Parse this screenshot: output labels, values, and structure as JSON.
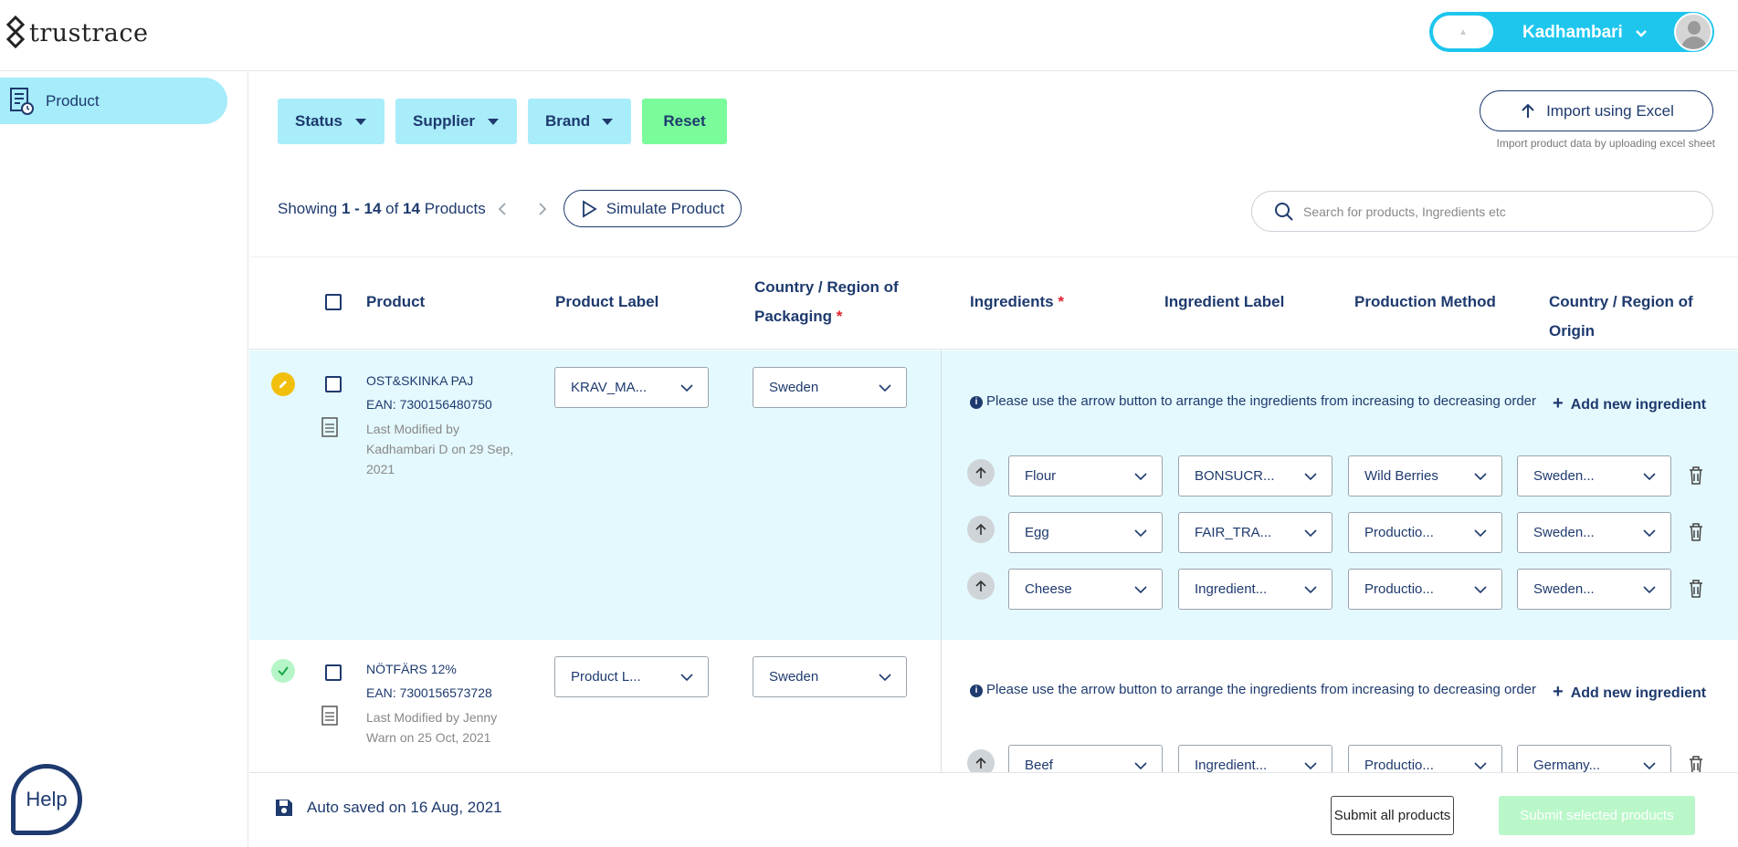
{
  "header": {
    "logo_text": "trustrace",
    "user_name": "Kadhambari"
  },
  "sidebar": {
    "items": [
      {
        "label": "Product"
      }
    ],
    "help_label": "Help"
  },
  "filters": {
    "status_label": "Status",
    "supplier_label": "Supplier",
    "brand_label": "Brand",
    "reset_label": "Reset"
  },
  "import": {
    "button_label": "Import using Excel",
    "hint": "Import product data by uploading excel sheet"
  },
  "listing": {
    "showing_prefix": "Showing ",
    "range": "1 - 14",
    "of": " of ",
    "total": "14",
    "suffix": " Products",
    "simulate_label": "Simulate Product"
  },
  "search": {
    "placeholder": "Search for products, Ingredients etc"
  },
  "table": {
    "columns": {
      "product": "Product",
      "product_label": "Product Label",
      "country_packaging": "Country / Region of Packaging",
      "required_mark": "*",
      "ingredients": "Ingredients",
      "ingredient_label": "Ingredient Label",
      "production_method": "Production Method",
      "country_origin": "Country / Region of Origin"
    },
    "ingredient_note": "Please use the arrow button to arrange the ingredients from increasing to decreasing order",
    "add_ingredient_label": "Add new ingredient",
    "rows": [
      {
        "status": "editing",
        "name": "OST&SKINKA PAJ",
        "ean": "EAN:  7300156480750",
        "modified": "Last Modified by Kadhambari D on 29 Sep, 2021",
        "product_label": "KRAV_MA...",
        "packaging_country": "Sweden",
        "ingredients": [
          {
            "name": "Flour",
            "label": "BONSUCR...",
            "method": "Wild Berries",
            "origin": "Sweden..."
          },
          {
            "name": "Egg",
            "label": "FAIR_TRA...",
            "method": "Productio...",
            "origin": "Sweden..."
          },
          {
            "name": "Cheese",
            "label": "Ingredient...",
            "method": "Productio...",
            "origin": "Sweden..."
          }
        ]
      },
      {
        "status": "complete",
        "name": "NÖTFÄRS 12%",
        "ean": "EAN:  7300156573728",
        "modified": "Last Modified by Jenny Warn on 25 Oct, 2021",
        "product_label": "Product L...",
        "packaging_country": "Sweden",
        "ingredients": [
          {
            "name": "Beef",
            "label": "Ingredient...",
            "method": "Productio...",
            "origin": "Germany..."
          }
        ]
      }
    ]
  },
  "footer": {
    "autosave": "Auto saved on 16 Aug, 2021",
    "submit_all": "Submit all products",
    "submit_selected": "Submit selected products"
  },
  "colors": {
    "primary": "#1e3a6e",
    "accent_cyan": "#1ec6ee",
    "filter_bg": "#a9ecfa",
    "reset_bg": "#7afc9a",
    "row_highlight": "#e4f9fd",
    "edit_status": "#f2bf0c",
    "complete_status": "#b6f5c8"
  }
}
